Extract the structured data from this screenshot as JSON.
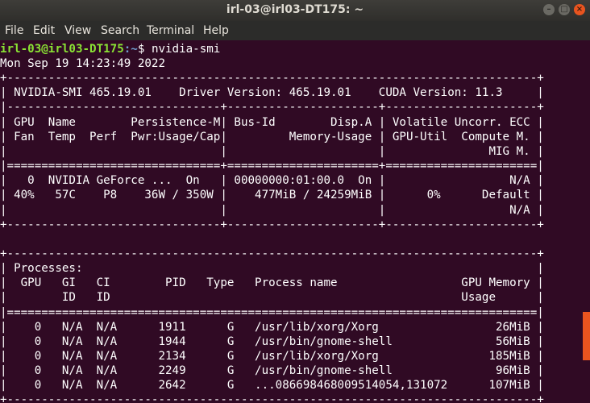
{
  "window": {
    "title": "irl-03@irl03-DT175: ~",
    "min_icon": "–",
    "max_icon": "□",
    "close_icon": "×"
  },
  "menu": [
    "File",
    "Edit",
    "View",
    "Search",
    "Terminal",
    "Help"
  ],
  "prompt": {
    "user_host": "irl-03@irl03-DT175",
    "path": ":~",
    "symbol": "$ ",
    "command": "nvidia-smi"
  },
  "output": [
    "Mon Sep 19 14:23:49 2022",
    "+-----------------------------------------------------------------------------+",
    "| NVIDIA-SMI 465.19.01    Driver Version: 465.19.01    CUDA Version: 11.3     |",
    "|-------------------------------+----------------------+----------------------+",
    "| GPU  Name        Persistence-M| Bus-Id        Disp.A | Volatile Uncorr. ECC |",
    "| Fan  Temp  Perf  Pwr:Usage/Cap|         Memory-Usage | GPU-Util  Compute M. |",
    "|                               |                      |               MIG M. |",
    "|===============================+======================+======================|",
    "|   0  NVIDIA GeForce ...  On   | 00000000:01:00.0  On |                  N/A |",
    "| 40%   57C    P8    36W / 350W |    477MiB / 24259MiB |      0%      Default |",
    "|                               |                      |                  N/A |",
    "+-------------------------------+----------------------+----------------------+",
    "",
    "+-----------------------------------------------------------------------------+",
    "| Processes:                                                                  |",
    "|  GPU   GI   CI        PID   Type   Process name                  GPU Memory |",
    "|        ID   ID                                                   Usage      |",
    "|=============================================================================|",
    "|    0   N/A  N/A      1911      G   /usr/lib/xorg/Xorg                 26MiB |",
    "|    0   N/A  N/A      1944      G   /usr/bin/gnome-shell               56MiB |",
    "|    0   N/A  N/A      2134      G   /usr/lib/xorg/Xorg                185MiB |",
    "|    0   N/A  N/A      2249      G   /usr/bin/gnome-shell               96MiB |",
    "|    0   N/A  N/A      2642      G   ...086698468009514054,131072      107MiB |",
    "+-----------------------------------------------------------------------------+"
  ],
  "colors": {
    "background": "#300a24",
    "prompt_user": "#8ae234",
    "prompt_path": "#729fcf",
    "scroll_thumb": "#e9541f"
  }
}
